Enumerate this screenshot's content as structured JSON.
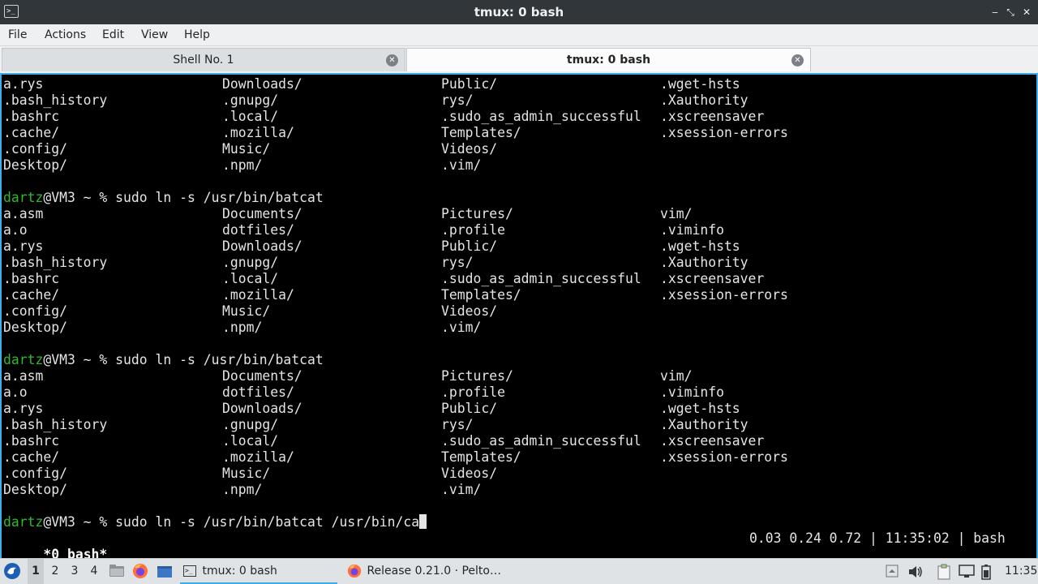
{
  "window": {
    "title": "tmux: 0 bash",
    "app_icon": "terminal-icon",
    "minimize": "‒",
    "maximize": "⤡",
    "close": "✕"
  },
  "menu": [
    "File",
    "Actions",
    "Edit",
    "View",
    "Help"
  ],
  "tabs": [
    {
      "label": "Shell No. 1",
      "active": false
    },
    {
      "label": "tmux: 0 bash",
      "active": true
    }
  ],
  "terminal": {
    "listing_top": [
      [
        "a.rys",
        "Downloads/",
        "Public/",
        ".wget-hsts"
      ],
      [
        ".bash_history",
        ".gnupg/",
        "rys/",
        ".Xauthority"
      ],
      [
        ".bashrc",
        ".local/",
        ".sudo_as_admin_successful",
        ".xscreensaver"
      ],
      [
        ".cache/",
        ".mozilla/",
        "Templates/",
        ".xsession-errors"
      ],
      [
        ".config/",
        "Music/",
        "Videos/",
        ""
      ],
      [
        "Desktop/",
        ".npm/",
        ".vim/",
        ""
      ]
    ],
    "prompt_user": "dartz",
    "prompt_rest": "@VM3 ~ % ",
    "command_1": "sudo ln -s /usr/bin/batcat",
    "listing_full": [
      [
        "a.asm",
        "Documents/",
        "Pictures/",
        "vim/"
      ],
      [
        "a.o",
        "dotfiles/",
        ".profile",
        ".viminfo"
      ],
      [
        "a.rys",
        "Downloads/",
        "Public/",
        ".wget-hsts"
      ],
      [
        ".bash_history",
        ".gnupg/",
        "rys/",
        ".Xauthority"
      ],
      [
        ".bashrc",
        ".local/",
        ".sudo_as_admin_successful",
        ".xscreensaver"
      ],
      [
        ".cache/",
        ".mozilla/",
        "Templates/",
        ".xsession-errors"
      ],
      [
        ".config/",
        "Music/",
        "Videos/",
        ""
      ],
      [
        "Desktop/",
        ".npm/",
        ".vim/",
        ""
      ]
    ],
    "command_current": "sudo ln -s /usr/bin/batcat /usr/bin/ca",
    "status_left": " *0 bash*",
    "status_right": "0.03 0.24 0.72 | 11:35:02 | bash"
  },
  "taskbar": {
    "workspaces": [
      "1",
      "2",
      "3",
      "4"
    ],
    "active_workspace": "1",
    "tasks": [
      {
        "label": "tmux: 0 bash",
        "icon": "terminal-icon",
        "active": true
      },
      {
        "label": "Release 0.21.0 · Pelto…",
        "icon": "firefox-icon",
        "active": false
      }
    ],
    "clock": "11:35"
  }
}
